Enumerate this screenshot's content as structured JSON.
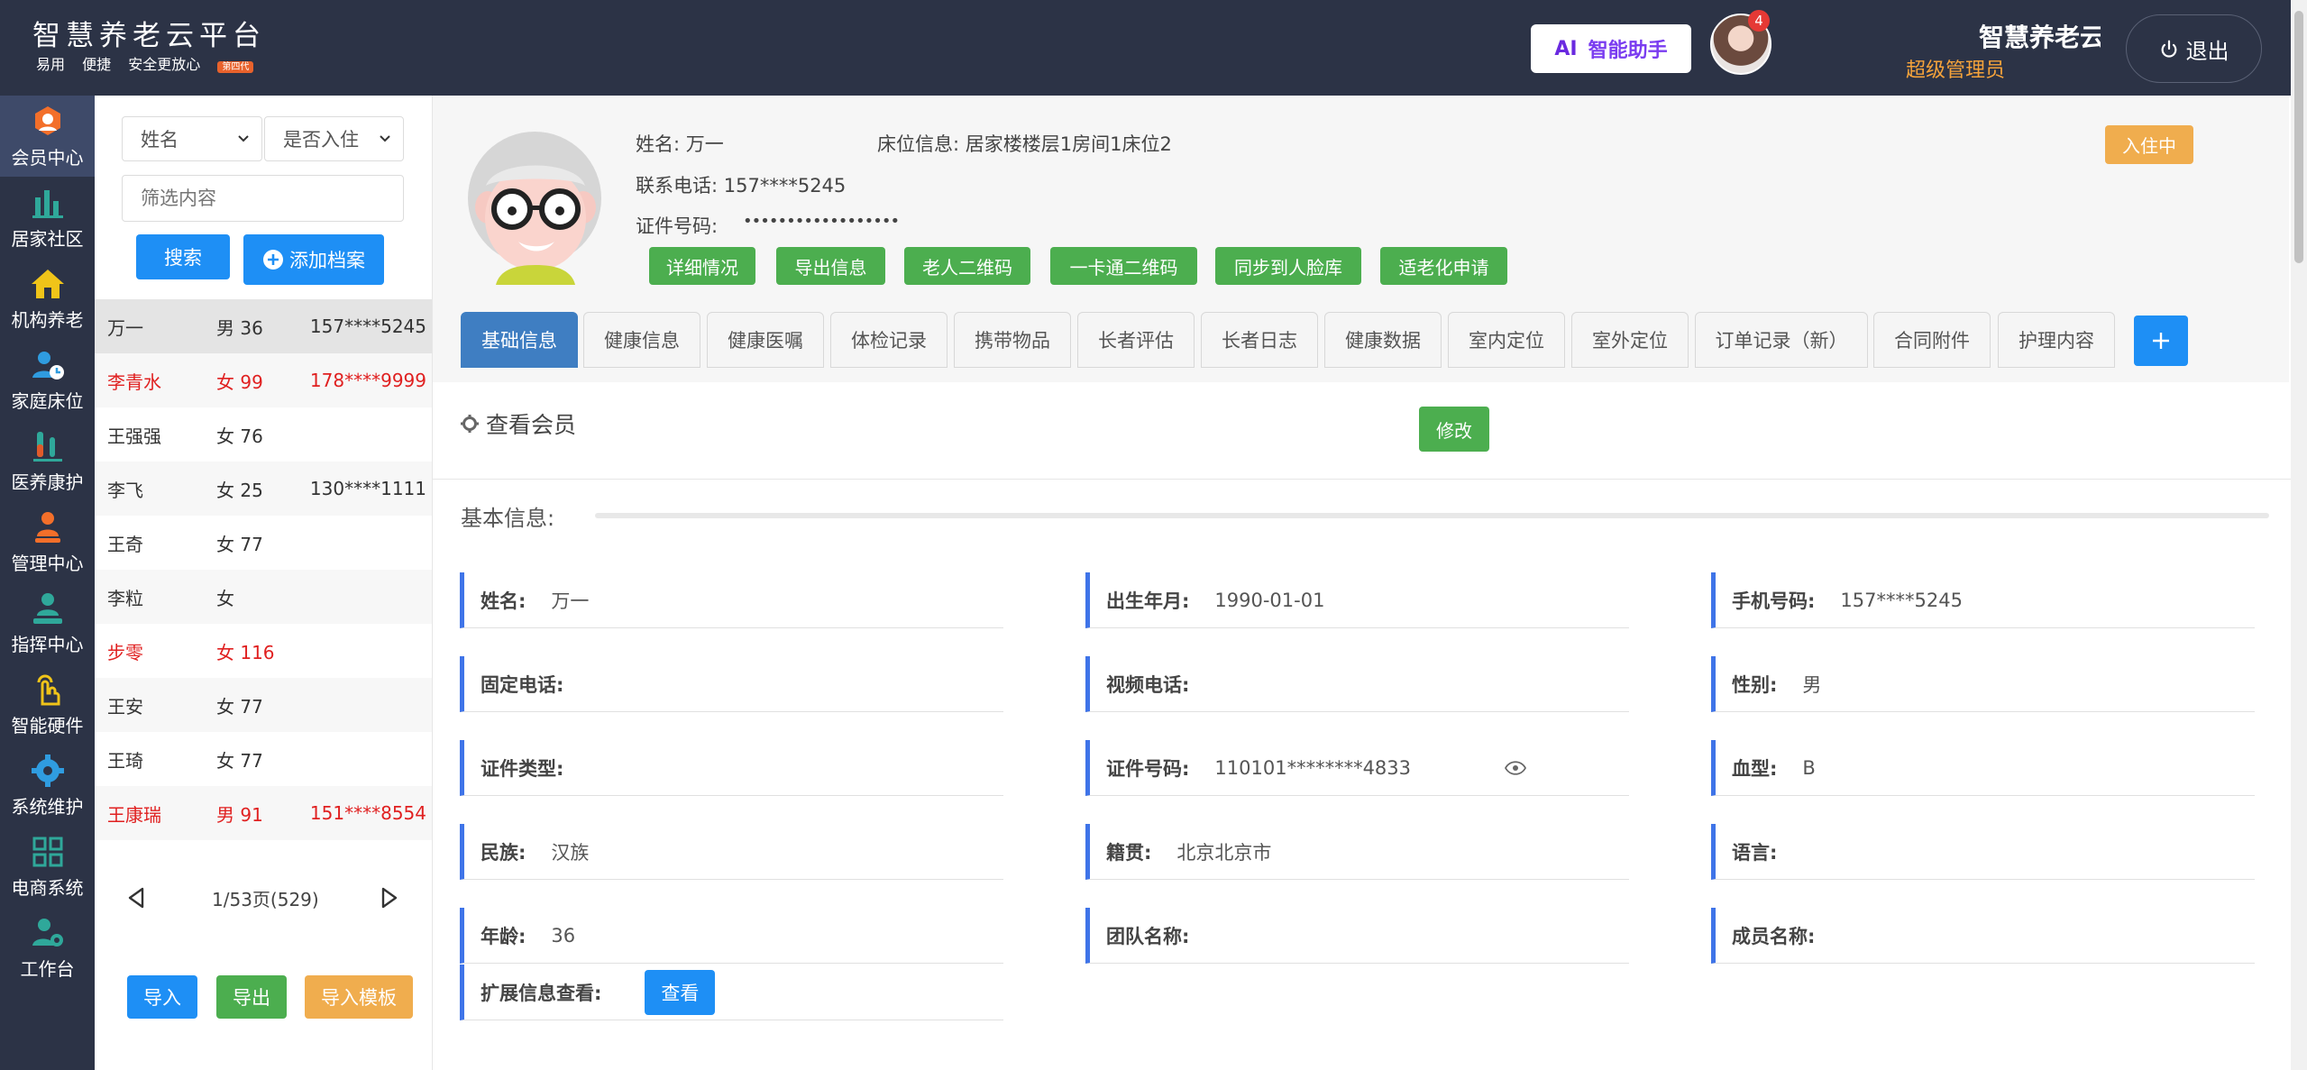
{
  "header": {
    "title": "智慧养老云平台",
    "tags": [
      "易用",
      "便捷",
      "安全更放心"
    ],
    "gen_badge": "第四代",
    "ai_label": "AI",
    "ai_text": "智能助手",
    "notification_count": "4",
    "brand_name": "智慧养老云平台",
    "role": "超级管理员",
    "logout": "退出"
  },
  "sidebar": {
    "items": [
      {
        "label": "会员中心",
        "icon": "member-center-icon",
        "active": true
      },
      {
        "label": "居家社区",
        "icon": "community-chart-icon"
      },
      {
        "label": "机构养老",
        "icon": "house-icon"
      },
      {
        "label": "家庭床位",
        "icon": "family-bed-icon"
      },
      {
        "label": "医养康护",
        "icon": "medical-tube-icon"
      },
      {
        "label": "管理中心",
        "icon": "manager-icon"
      },
      {
        "label": "指挥中心",
        "icon": "command-icon"
      },
      {
        "label": "智能硬件",
        "icon": "touch-icon"
      },
      {
        "label": "系统维护",
        "icon": "gear-icon"
      },
      {
        "label": "电商系统",
        "icon": "grid-icon"
      },
      {
        "label": "工作台",
        "icon": "workbench-icon"
      }
    ]
  },
  "list_panel": {
    "name_select": "姓名",
    "checkin_select": "是否入住",
    "filter_placeholder": "筛选内容",
    "search": "搜索",
    "add_record": "添加档案",
    "members": [
      {
        "name": "万一",
        "sex_age": "男 36",
        "phone": "157****5245",
        "red": false
      },
      {
        "name": "李青水",
        "sex_age": "女 99",
        "phone": "178****9999",
        "red": true
      },
      {
        "name": "王强强",
        "sex_age": "女 76",
        "phone": "",
        "red": false
      },
      {
        "name": "李飞",
        "sex_age": "女 25",
        "phone": "130****1111",
        "red": false
      },
      {
        "name": "王奇",
        "sex_age": "女 77",
        "phone": "",
        "red": false
      },
      {
        "name": "李粒",
        "sex_age": "女",
        "phone": "",
        "red": false
      },
      {
        "name": "步零",
        "sex_age": "女 116",
        "phone": "",
        "red": true
      },
      {
        "name": "王安",
        "sex_age": "女 77",
        "phone": "",
        "red": false
      },
      {
        "name": "王琦",
        "sex_age": "女 77",
        "phone": "",
        "red": false
      },
      {
        "name": "王康瑞",
        "sex_age": "男 91",
        "phone": "151****8554",
        "red": true
      }
    ],
    "pager": "1/53页(529)",
    "import": "导入",
    "export": "导出",
    "import_template": "导入模板"
  },
  "profile": {
    "name": "姓名:  万一",
    "bed": "床位信息:  居家楼楼层1房间1床位2",
    "phone": "联系电话:  157****5245",
    "id_label": "证件号码:",
    "id_masked": "••••••••••••••••••",
    "status": "入住中",
    "actions": [
      "详细情况",
      "导出信息",
      "老人二维码",
      "一卡通二维码",
      "同步到人脸库",
      "适老化申请"
    ]
  },
  "tabs": [
    "基础信息",
    "健康信息",
    "健康医嘱",
    "体检记录",
    "携带物品",
    "长者评估",
    "长者日志",
    "健康数据",
    "室内定位",
    "室外定位",
    "订单记录（新）",
    "合同附件",
    "护理内容"
  ],
  "section": {
    "title": "查看会员",
    "edit": "修改",
    "basic_info": "基本信息:"
  },
  "fields": [
    {
      "label": "姓名:",
      "value": "万一"
    },
    {
      "label": "出生年月:",
      "value": "1990-01-01"
    },
    {
      "label": "手机号码:",
      "value": "157****5245"
    },
    {
      "label": "固定电话:",
      "value": ""
    },
    {
      "label": "视频电话:",
      "value": ""
    },
    {
      "label": "性别:",
      "value": "男"
    },
    {
      "label": "证件类型:",
      "value": ""
    },
    {
      "label": "证件号码:",
      "value": "110101********4833"
    },
    {
      "label": "血型:",
      "value": "B"
    },
    {
      "label": "民族:",
      "value": "汉族"
    },
    {
      "label": "籍贯:",
      "value": "北京北京市"
    },
    {
      "label": "语言:",
      "value": ""
    },
    {
      "label": "年龄:",
      "value": "36"
    },
    {
      "label": "团队名称:",
      "value": ""
    },
    {
      "label": "成员名称:",
      "value": ""
    }
  ],
  "ext": {
    "label": "扩展信息查看:",
    "button": "查看"
  },
  "colors": {
    "header_bg": "#2c3346",
    "accent_blue": "#1e8ff5",
    "green": "#4cae4f",
    "orange": "#f0ad4e",
    "field_border": "#3f74e8"
  }
}
